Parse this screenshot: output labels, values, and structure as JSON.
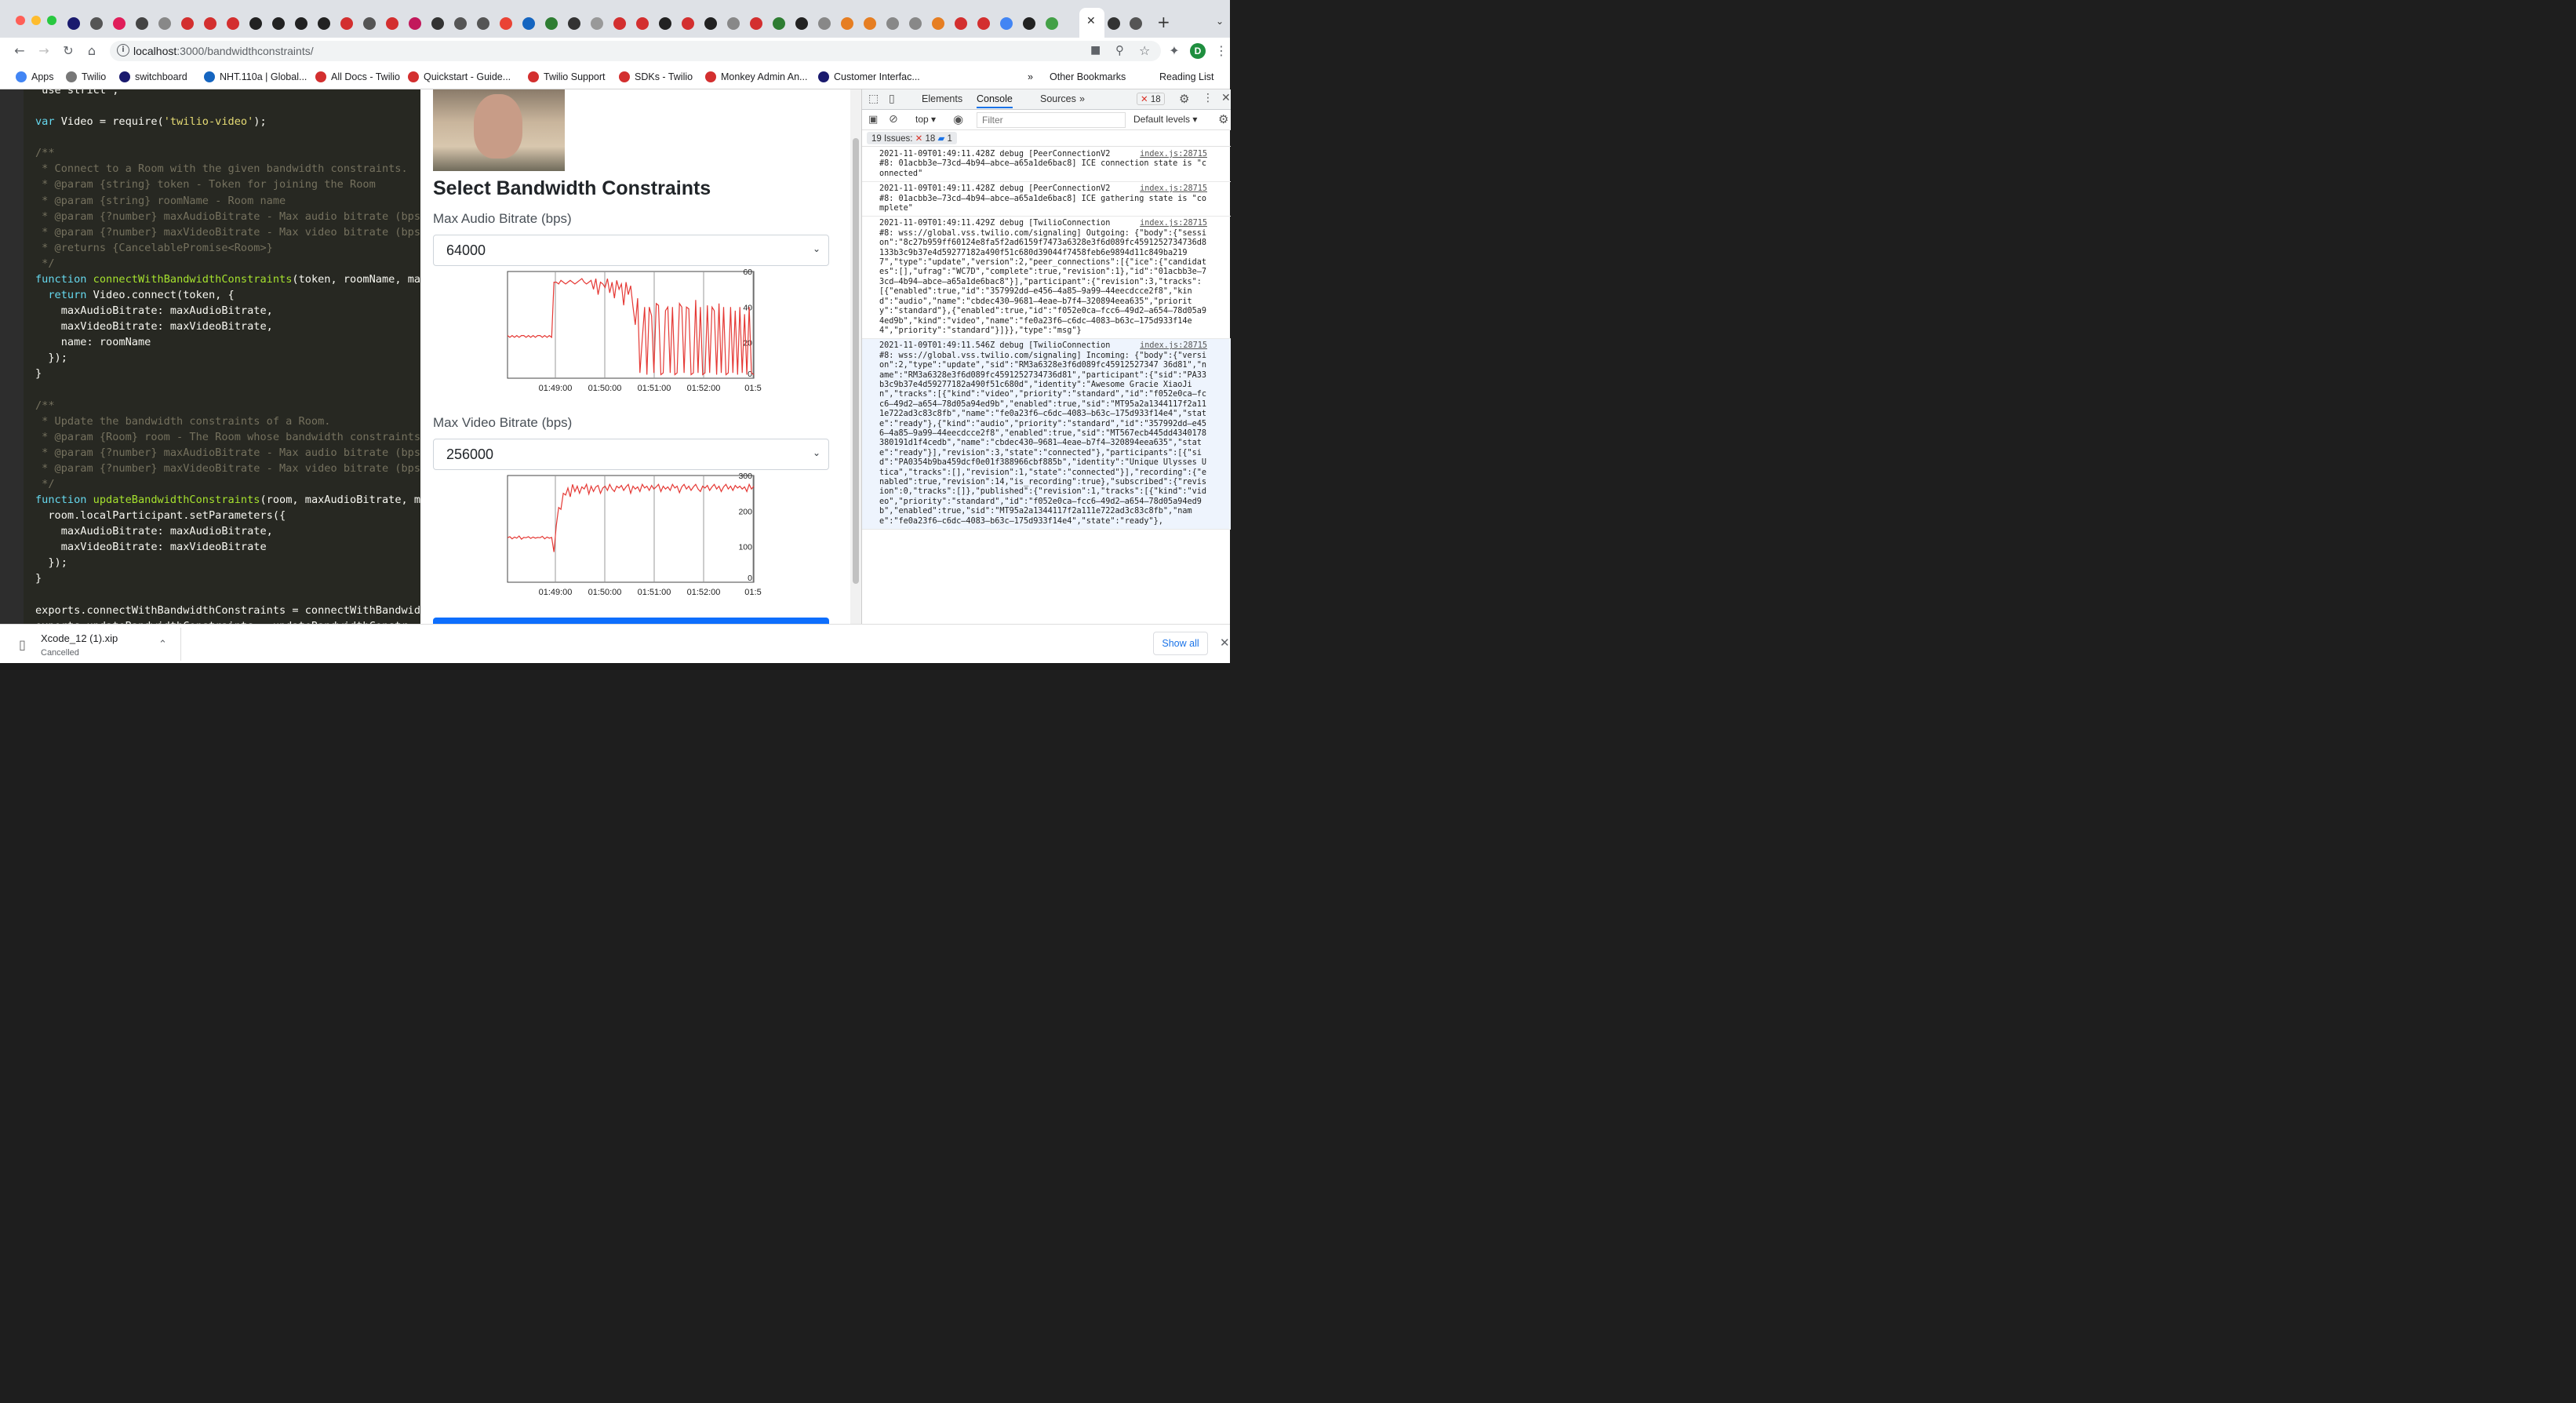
{
  "browser": {
    "url_host": "localhost",
    "url_path": ":3000/bandwidthconstraints/",
    "profile_initial": "D",
    "bookmarks": [
      "Apps",
      "Twilio",
      "switchboard",
      "NHT.110a | Global...",
      "All Docs - Twilio",
      "Quickstart - Guide...",
      "Twilio Support",
      "SDKs - Twilio",
      "Monkey Admin An...",
      "Customer Interfac..."
    ],
    "bookmarks_more": "»",
    "other_bookmarks": "Other Bookmarks",
    "reading_list": "Reading List",
    "colors": {
      "chrome": "#dee1e6",
      "accent": "#1a73e8"
    }
  },
  "code": {
    "lines": [
      " use strict ;",
      "",
      "var Video = require('twilio-video');",
      "",
      "/**",
      " * Connect to a Room with the given bandwidth constraints.",
      " * @param {string} token - Token for joining the Room",
      " * @param {string} roomName - Room name",
      " * @param {?number} maxAudioBitrate - Max audio bitrate (bps",
      " * @param {?number} maxVideoBitrate - Max video bitrate (bps",
      " * @returns {CancelablePromise<Room>}",
      " */",
      "function connectWithBandwidthConstraints(token, roomName, ma",
      "  return Video.connect(token, {",
      "    maxAudioBitrate: maxAudioBitrate,",
      "    maxVideoBitrate: maxVideoBitrate,",
      "    name: roomName",
      "  });",
      "}",
      "",
      "/**",
      " * Update the bandwidth constraints of a Room.",
      " * @param {Room} room - The Room whose bandwidth constraints",
      " * @param {?number} maxAudioBitrate - Max audio bitrate (bps",
      " * @param {?number} maxVideoBitrate - Max video bitrate (bps",
      " */",
      "function updateBandwidthConstraints(room, maxAudioBitrate, m",
      "  room.localParticipant.setParameters({",
      "    maxAudioBitrate: maxAudioBitrate,",
      "    maxVideoBitrate: maxVideoBitrate",
      "  });",
      "}",
      "",
      "exports.connectWithBandwidthConstraints = connectWithBandwid",
      "exports.updateBandwidthConstraints = updateBandwidthConstr"
    ]
  },
  "app": {
    "title": "Select Bandwidth Constraints",
    "audio_label": "Max Audio Bitrate (bps)",
    "audio_value": "64000",
    "video_label": "Max Video Bitrate (bps)",
    "video_value": "256000"
  },
  "chart_data": [
    {
      "type": "line",
      "title": "",
      "x_ticks": [
        "01:49:00",
        "01:50:00",
        "01:51:00",
        "01:52:00",
        "01:5"
      ],
      "y_ticks": [
        0,
        20,
        40,
        60
      ],
      "ylim": [
        0,
        60
      ],
      "series_color": "#e53935",
      "series": [
        {
          "values": [
            24,
            23,
            24,
            23,
            24,
            23,
            24,
            24,
            23,
            24,
            23,
            24,
            23,
            24,
            24,
            23,
            24,
            23,
            24,
            23,
            54,
            54,
            53,
            55,
            54,
            53,
            54,
            55,
            54,
            53,
            54,
            55,
            56,
            54,
            53,
            54,
            55,
            50,
            56,
            47,
            54,
            53,
            51,
            56,
            48,
            54,
            45,
            55,
            50,
            53,
            41,
            54,
            47,
            52,
            40,
            30,
            45,
            3,
            22,
            40,
            2,
            40,
            35,
            3,
            42,
            41,
            2,
            3,
            38,
            40,
            3,
            40,
            2,
            3,
            42,
            40,
            3,
            40,
            39,
            2,
            3,
            44,
            3,
            40,
            2,
            3,
            41,
            3,
            40,
            38,
            2,
            42,
            3,
            40,
            2,
            3,
            40,
            3,
            38,
            2,
            40,
            3,
            36,
            2,
            40,
            3,
            2
          ]
        }
      ]
    },
    {
      "type": "line",
      "title": "",
      "x_ticks": [
        "01:49:00",
        "01:50:00",
        "01:51:00",
        "01:52:00",
        "01:5"
      ],
      "y_ticks": [
        0,
        100,
        200,
        300
      ],
      "ylim": [
        0,
        300
      ],
      "series_color": "#e53935",
      "series": [
        {
          "values": [
            125,
            128,
            122,
            127,
            124,
            130,
            121,
            126,
            125,
            128,
            123,
            127,
            124,
            126,
            125,
            129,
            122,
            127,
            124,
            126,
            85,
            160,
            210,
            205,
            250,
            245,
            265,
            240,
            275,
            255,
            270,
            250,
            268,
            262,
            275,
            248,
            270,
            255,
            268,
            272,
            250,
            265,
            270,
            258,
            275,
            262,
            255,
            270,
            265,
            272,
            258,
            268,
            275,
            250,
            270,
            262,
            268,
            255,
            275,
            265,
            270,
            258,
            272,
            262,
            268,
            275,
            255,
            270,
            262,
            268,
            258,
            275,
            265,
            270,
            252,
            268,
            275,
            262,
            270,
            258,
            268,
            275,
            262,
            255,
            270,
            265,
            272,
            258,
            268,
            275,
            262,
            270,
            255,
            268,
            275,
            262,
            270,
            258,
            272,
            265,
            270,
            262,
            268,
            255,
            275,
            262,
            270
          ]
        }
      ]
    }
  ],
  "devtools": {
    "tabs": [
      "Elements",
      "Console",
      "Sources",
      "»"
    ],
    "active_tab": "Console",
    "error_count": "18",
    "context": "top",
    "filter_placeholder": "Filter",
    "levels": "Default levels",
    "issues_label": "19 Issues:",
    "issues_errors": "18",
    "issues_info": "1",
    "logs": [
      {
        "text": "2021-11-09T01:49:11.428Z debug [PeerConnectionV2\n#8: 01acbb3e–73cd–4b94–abce–a65a1de6bac8] ICE connection state is \"connected\"",
        "src": "index.js:28715"
      },
      {
        "text": "2021-11-09T01:49:11.428Z debug [PeerConnectionV2\n#8: 01acbb3e–73cd–4b94–abce–a65a1de6bac8] ICE gathering state is \"complete\"",
        "src": "index.js:28715"
      },
      {
        "text": "2021-11-09T01:49:11.429Z debug [TwilioConnection\n#8: wss://global.vss.twilio.com/signaling] Outgoing: {\"body\":{\"session\":\"8c27b959ff60124e8fa5f2ad6159f7473a6328e3f6d089fc4591252734736d8133b3c9b37e4d59277182a490f51c680d39044f7458feb6e9894d11c849ba2197\",\"type\":\"update\",\"version\":2,\"peer_connections\":[{\"ice\":{\"candidates\":[],\"ufrag\":\"WC7D\",\"complete\":true,\"revision\":1},\"id\":\"01acbb3e–73cd–4b94–abce–a65a1de6bac8\"}],\"participant\":{\"revision\":3,\"tracks\":[{\"enabled\":true,\"id\":\"357992dd–e456–4a85–9a99–44eecdcce2f8\",\"kind\":\"audio\",\"name\":\"cbdec430–9681–4eae–b7f4–320894eea635\",\"priority\":\"standard\"},{\"enabled\":true,\"id\":\"f052e0ca–fcc6–49d2–a654–78d05a94ed9b\",\"kind\":\"video\",\"name\":\"fe0a23f6–c6dc–4083–b63c–175d933f14e4\",\"priority\":\"standard\"}]}},\"type\":\"msg\"}",
        "src": "index.js:28715"
      },
      {
        "text": "2021-11-09T01:49:11.546Z debug [TwilioConnection\n#8: wss://global.vss.twilio.com/signaling] Incoming: {\"body\":{\"version\":2,\"type\":\"update\",\"sid\":\"RM3a6328e3f6d089fc45912527347 36d81\",\"name\":\"RM3a6328e3f6d089fc4591252734736d81\",\"participant\":{\"sid\":\"PA33b3c9b37e4d59277182a490f51c680d\",\"identity\":\"Awesome Gracie XiaoJin\",\"tracks\":[{\"kind\":\"video\",\"priority\":\"standard\",\"id\":\"f052e0ca–fcc6–49d2–a654–78d05a94ed9b\",\"enabled\":true,\"sid\":\"MT95a2a1344117f2a111e722ad3c83c8fb\",\"name\":\"fe0a23f6–c6dc–4083–b63c–175d933f14e4\",\"state\":\"ready\"},{\"kind\":\"audio\",\"priority\":\"standard\",\"id\":\"357992dd–e456–4a85–9a99–44eecdcce2f8\",\"enabled\":true,\"sid\":\"MT567ecb445dd4340178380191d1f4cedb\",\"name\":\"cbdec430–9681–4eae–b7f4–320894eea635\",\"state\":\"ready\"}],\"revision\":3,\"state\":\"connected\"},\"participants\":[{\"sid\":\"PA0354b9ba459dcf0e01f388966cbf885b\",\"identity\":\"Unique Ulysses Utica\",\"tracks\":[],\"revision\":1,\"state\":\"connected\"}],\"recording\":{\"enabled\":true,\"revision\":14,\"is_recording\":true},\"subscribed\":{\"revision\":0,\"tracks\":[]},\"published\":{\"revision\":1,\"tracks\":[{\"kind\":\"video\",\"priority\":\"standard\",\"id\":\"f052e0ca–fcc6–49d2–a654–78d05a94ed9b\",\"enabled\":true,\"sid\":\"MT95a2a1344117f2a111e722ad3c83c8fb\",\"name\":\"fe0a23f6–c6dc–4083–b63c–175d933f14e4\",\"state\":\"ready\"},",
        "src": "index.js:28715"
      }
    ]
  },
  "download": {
    "filename": "Xcode_12 (1).xip",
    "status": "Cancelled",
    "show_all": "Show all"
  }
}
